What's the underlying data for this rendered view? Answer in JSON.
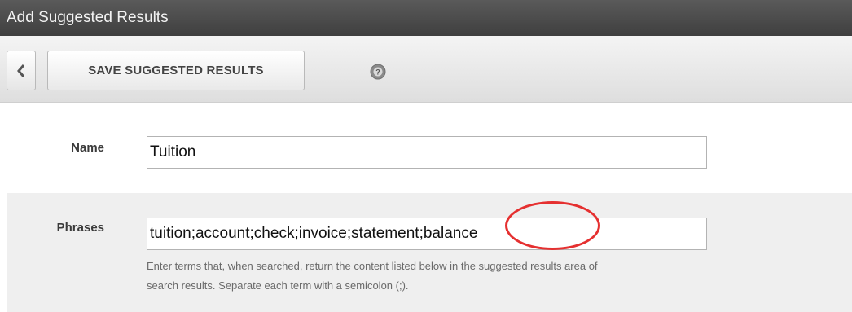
{
  "window": {
    "title": "Add Suggested Results"
  },
  "toolbar": {
    "back_icon": "chevron-left-icon",
    "save_label": "SAVE SUGGESTED RESULTS",
    "help_icon": "help-icon"
  },
  "form": {
    "name": {
      "label": "Name",
      "value": "Tuition"
    },
    "phrases": {
      "label": "Phrases",
      "value": "tuition;account;check;invoice;statement;balance",
      "help_line1": "Enter terms that, when searched, return the content listed below in the suggested results area of",
      "help_line2": "search results. Separate each term with a semicolon (;)."
    }
  },
  "annotation": {
    "color": "#e53030"
  }
}
